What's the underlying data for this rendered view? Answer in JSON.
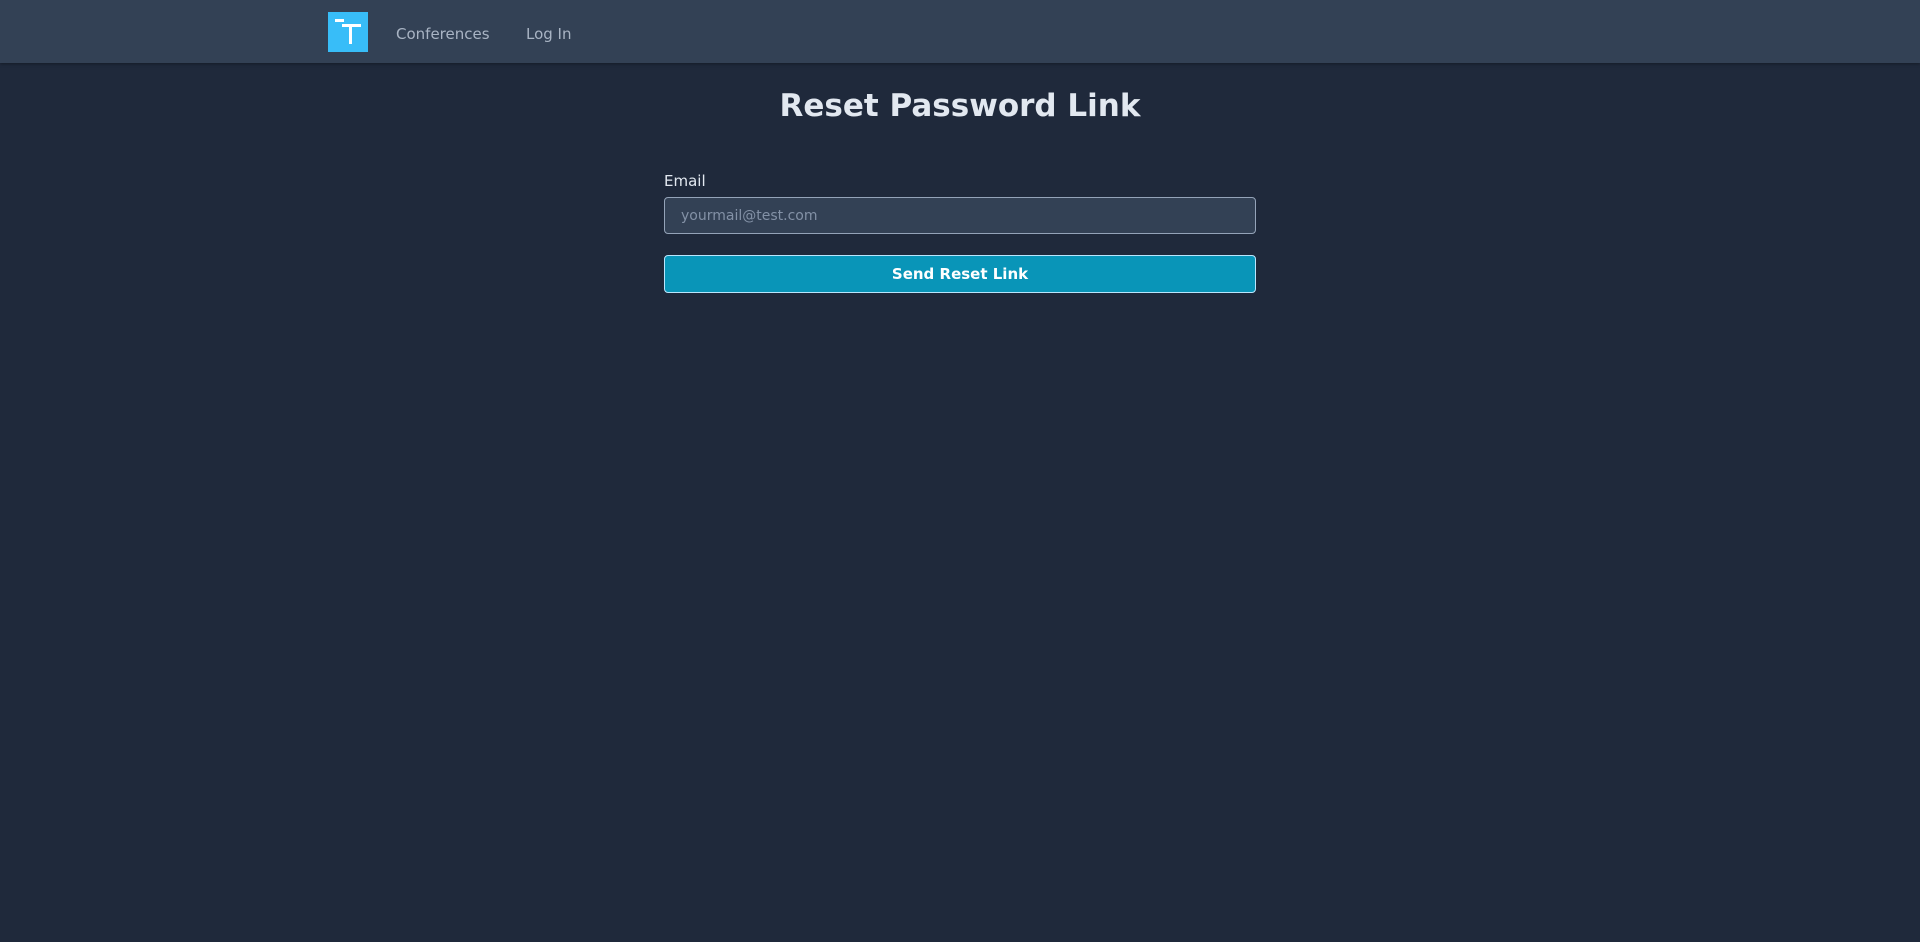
{
  "nav": {
    "logo_icon": "t-logo-icon",
    "logo_color": "#38bdf8",
    "links": [
      {
        "label": "Conferences"
      },
      {
        "label": "Log In"
      }
    ]
  },
  "page": {
    "title": "Reset Password Link"
  },
  "form": {
    "email_label": "Email",
    "email_value": "",
    "email_placeholder": "yourmail@test.com",
    "submit_label": "Send Reset Link"
  },
  "colors": {
    "background": "#1f293b",
    "navbar": "#334155",
    "accent": "#0995b8"
  }
}
